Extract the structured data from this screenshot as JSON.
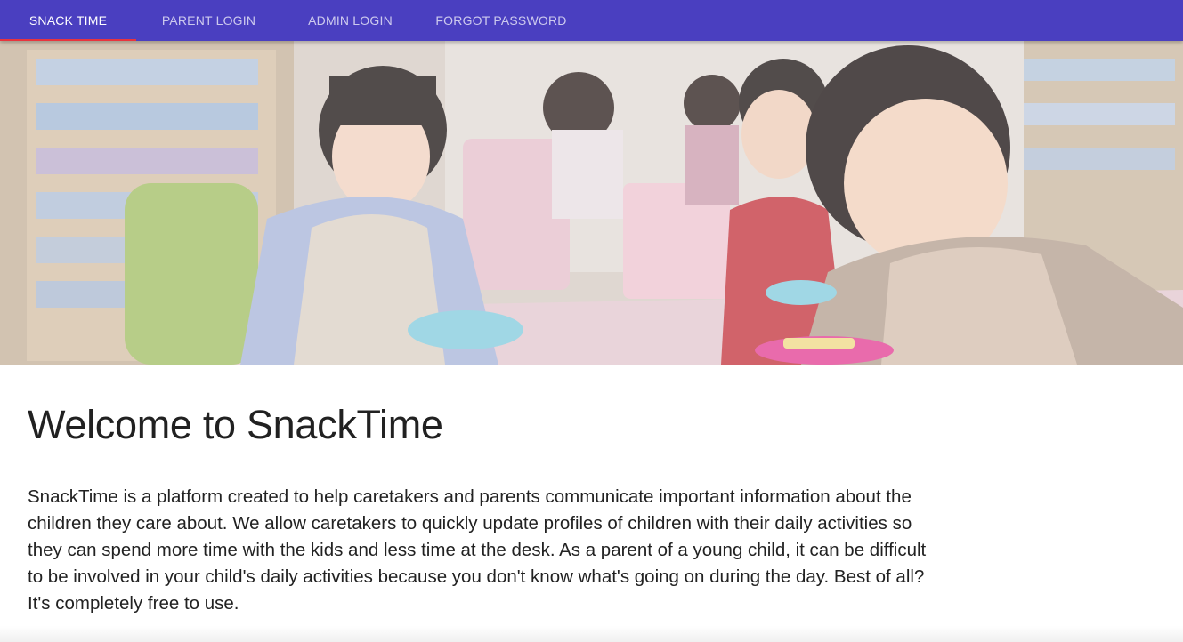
{
  "nav": {
    "tabs": [
      {
        "label": "SNACK TIME",
        "active": true
      },
      {
        "label": "PARENT LOGIN",
        "active": false
      },
      {
        "label": "ADMIN LOGIN",
        "active": false
      },
      {
        "label": "FORGOT PASSWORD",
        "active": false
      }
    ]
  },
  "hero": {
    "image": "children-eating-snacks-photo"
  },
  "main": {
    "title": "Welcome to SnackTime",
    "description": "SnackTime is a platform created to help caretakers and parents communicate important information about the children they care about. We allow caretakers to quickly update profiles of children with their daily activities so they can spend more time with the kids and less time at the desk. As a parent of a young child, it can be difficult to be involved in your child's daily activities because you don't know what's going on during the day. Best of all? It's completely free to use."
  },
  "colors": {
    "nav_background": "#4a3fc0",
    "active_tab_indicator": "#e8343d",
    "text": "#212121"
  }
}
